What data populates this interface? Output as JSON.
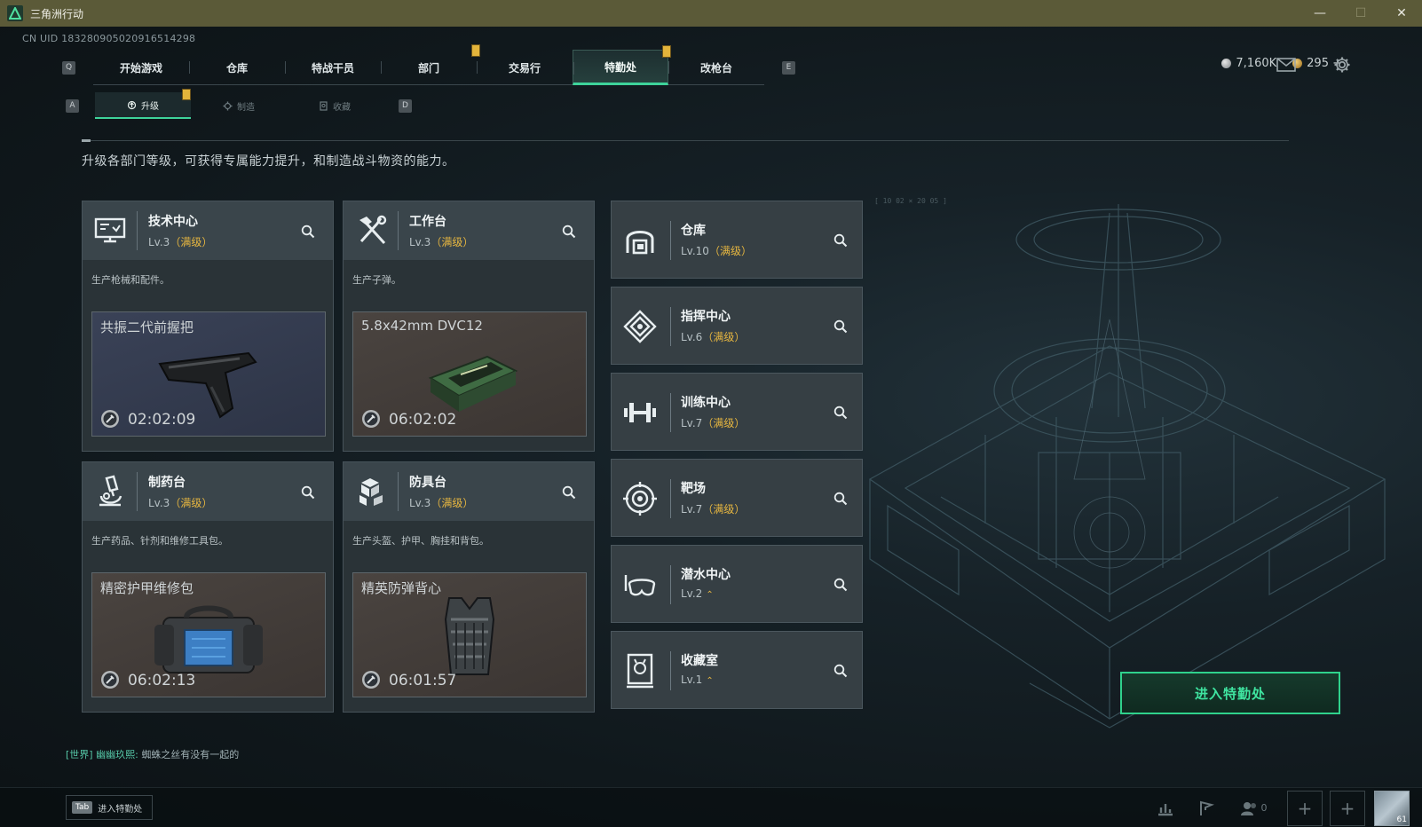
{
  "window": {
    "title": "三角洲行动",
    "minimize": "—",
    "maximize": "☐",
    "close": "✕"
  },
  "uid": "CN UID 183280905020916514298",
  "topnav": {
    "left_key": "Q",
    "right_key": "E",
    "tabs": [
      {
        "label": "开始游戏"
      },
      {
        "label": "仓库"
      },
      {
        "label": "特战干员"
      },
      {
        "label": "部门"
      },
      {
        "label": "交易行"
      },
      {
        "label": "特勤处"
      },
      {
        "label": "改枪台"
      }
    ]
  },
  "currency": {
    "silver": "7,160K",
    "gold": "295 +"
  },
  "subnav": {
    "left_key": "A",
    "right_key": "D",
    "tabs": [
      {
        "label": "升级"
      },
      {
        "label": "制造"
      },
      {
        "label": "收藏"
      }
    ]
  },
  "description": "升级各部门等级，可获得专属能力提升，和制造战斗物资的能力。",
  "cards": [
    {
      "title": "技术中心",
      "level": "Lv.3",
      "max": "（满级）",
      "desc": "生产枪械和配件。",
      "product": "共振二代前握把",
      "time": "02:02:09",
      "icon": "monitor-icon"
    },
    {
      "title": "工作台",
      "level": "Lv.3",
      "max": "（满级）",
      "desc": "生产子弹。",
      "product": "5.8x42mm DVC12",
      "time": "06:02:02",
      "icon": "hammer-wrench-icon"
    },
    {
      "title": "制药台",
      "level": "Lv.3",
      "max": "（满级）",
      "desc": "生产药品、针剂和维修工具包。",
      "product": "精密护甲维修包",
      "time": "06:02:13",
      "icon": "microscope-icon"
    },
    {
      "title": "防具台",
      "level": "Lv.3",
      "max": "（满级）",
      "desc": "生产头盔、护甲、胸挂和背包。",
      "product": "精英防弹背心",
      "time": "06:01:57",
      "icon": "armor-boxes-icon"
    }
  ],
  "side_cards": [
    {
      "title": "仓库",
      "level": "Lv.10",
      "max": "（满级）",
      "icon": "warehouse-icon"
    },
    {
      "title": "指挥中心",
      "level": "Lv.6",
      "max": "（满级）",
      "icon": "command-icon"
    },
    {
      "title": "训练中心",
      "level": "Lv.7",
      "max": "（满级）",
      "icon": "dumbbell-icon"
    },
    {
      "title": "靶场",
      "level": "Lv.7",
      "max": "（满级）",
      "icon": "target-icon"
    },
    {
      "title": "潜水中心",
      "level": "Lv.2",
      "max": "",
      "icon": "diving-mask-icon"
    },
    {
      "title": "收藏室",
      "level": "Lv.1",
      "max": "",
      "icon": "trophy-case-icon"
    }
  ],
  "enter_button": "进入特勤处",
  "chat": {
    "channel": "[世界]",
    "user": "幽幽玖熙:",
    "message": "蜘蛛之丝有没有一起的"
  },
  "bottom": {
    "tab_key": "Tab",
    "tab_label": "进入特勤处",
    "friends_count": "0",
    "avatar_level": "61"
  },
  "colors": {
    "accent": "#3ed39a",
    "gold": "#e6b640",
    "titlebar": "#5b5a38"
  }
}
